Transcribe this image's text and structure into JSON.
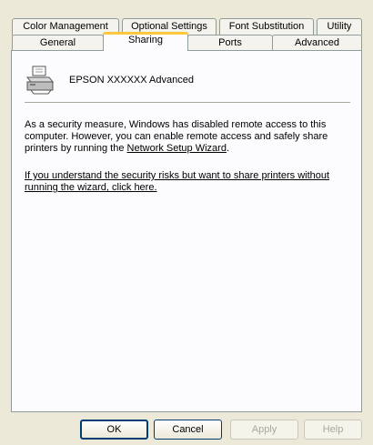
{
  "tabs_back": [
    "Color Management",
    "Optional Settings",
    "Font Substitution",
    "Utility"
  ],
  "tabs_front": [
    "General",
    "Sharing",
    "Ports",
    "Advanced"
  ],
  "selected_tab": "Sharing",
  "printer": {
    "name": "EPSON XXXXXX Advanced",
    "icon": "printer-icon"
  },
  "message": {
    "text_before": "As a security measure, Windows has disabled remote access to this computer. However, you can enable remote access and safely share printers by running the ",
    "link_label": "Network Setup Wizard",
    "text_after": "."
  },
  "risk_link": "If you understand the security risks but want to share printers without running the wizard, click here.",
  "buttons": {
    "ok": "OK",
    "cancel": "Cancel",
    "apply": "Apply",
    "help": "Help"
  },
  "colors": {
    "selected_tab_accent": "#ffc83c",
    "button_border": "#003c74"
  }
}
